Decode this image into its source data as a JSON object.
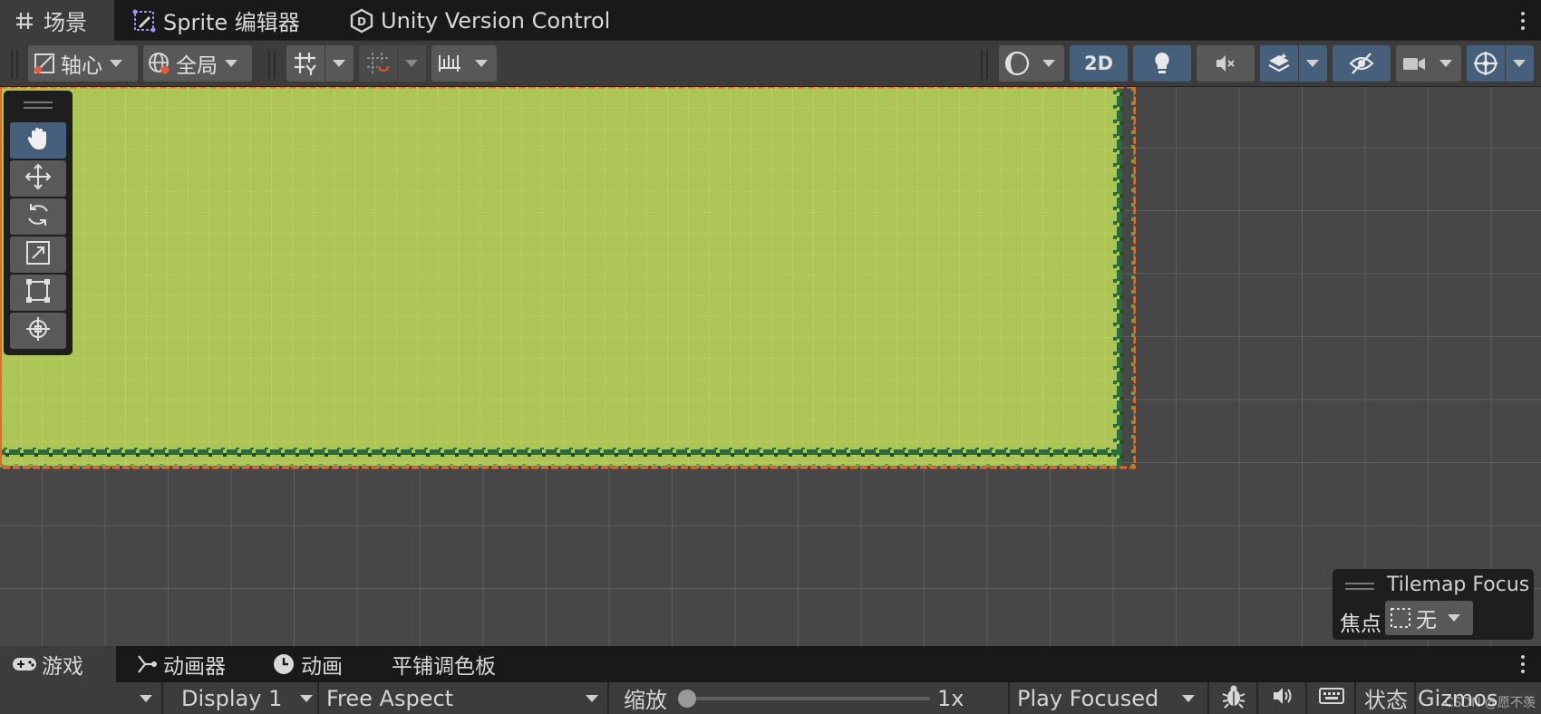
{
  "tabs": {
    "scene": "场景",
    "sprite_editor": "Sprite 编辑器",
    "version_control": "Unity Version Control"
  },
  "toolbar": {
    "pivot_label": "轴心",
    "global_label": "全局",
    "mode_2d": "2D"
  },
  "tool_palette": [
    "hand-icon",
    "move-icon",
    "rotate-icon",
    "scale-icon",
    "rect-icon",
    "transform-icon"
  ],
  "tilemap_focus": {
    "title": "Tilemap Focus",
    "label": "焦点",
    "value": "无"
  },
  "bottom_tabs": {
    "game": "游戏",
    "animator": "动画器",
    "animation": "动画",
    "tile_palette": "平铺调色板"
  },
  "game_bar": {
    "display": "Display 1",
    "aspect": "Free Aspect",
    "scale_label": "缩放",
    "scale_value": "1x",
    "play_mode": "Play Focused",
    "stats": "状态",
    "gizmos": "Gizmos",
    "watermark": "CSDN @愿不羡"
  },
  "colors": {
    "grass": "#adc556",
    "grass_dark": "#2c6b3b",
    "outline": "#e36a2a",
    "scene_bg": "#474747",
    "active_blue": "#46607c"
  }
}
